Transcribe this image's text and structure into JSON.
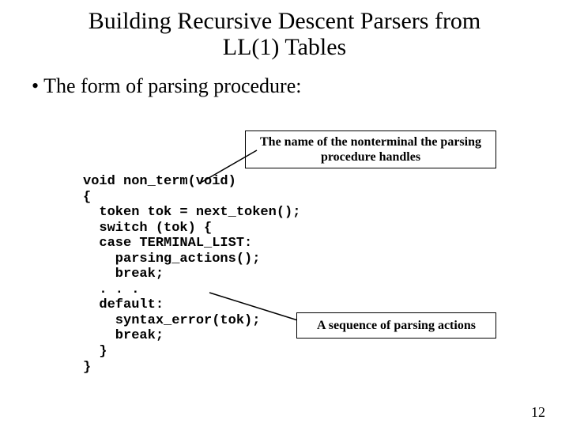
{
  "title_line1": "Building Recursive Descent Parsers from",
  "title_line2": "LL(1) Tables",
  "bullet_text": "• The form of parsing procedure:",
  "callout1_line1": "The name of the nonterminal the parsing",
  "callout1_line2": "procedure handles",
  "callout2_text": "A sequence of parsing actions",
  "code": {
    "l1": "void non_term(void)",
    "l2": "{",
    "l3": "  token tok = next_token();",
    "l4": "  switch (tok) {",
    "l5": "  case TERMINAL_LIST:",
    "l6": "    parsing_actions();",
    "l7": "    break;",
    "l8": "  . . .",
    "l9": "  default:",
    "l10": "    syntax_error(tok);",
    "l11": "    break;",
    "l12": "  }",
    "l13": "}"
  },
  "page_number": "12"
}
